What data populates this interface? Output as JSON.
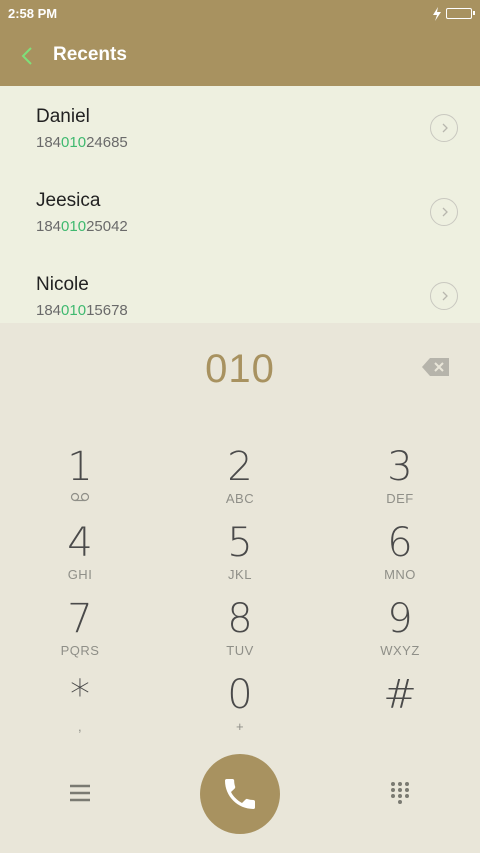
{
  "status_bar": {
    "time": "2:58 PM"
  },
  "header": {
    "title": "Recents"
  },
  "recents": [
    {
      "name": "Daniel",
      "number_prefix": "184",
      "number_match": "010",
      "number_suffix": "24685"
    },
    {
      "name": "Jeesica",
      "number_prefix": "184",
      "number_match": "010",
      "number_suffix": "25042"
    },
    {
      "name": "Nicole",
      "number_prefix": "184",
      "number_match": "010",
      "number_suffix": "15678"
    }
  ],
  "dialpad": {
    "entry": "010",
    "keys": [
      {
        "digit": "1",
        "sub": ""
      },
      {
        "digit": "2",
        "sub": "ABC"
      },
      {
        "digit": "3",
        "sub": "DEF"
      },
      {
        "digit": "4",
        "sub": "GHI"
      },
      {
        "digit": "5",
        "sub": "JKL"
      },
      {
        "digit": "6",
        "sub": "MNO"
      },
      {
        "digit": "7",
        "sub": "PQRS"
      },
      {
        "digit": "8",
        "sub": "TUV"
      },
      {
        "digit": "9",
        "sub": "WXYZ"
      },
      {
        "digit": "*",
        "sub": ","
      },
      {
        "digit": "0",
        "sub": "+"
      },
      {
        "digit": "#",
        "sub": ""
      }
    ]
  },
  "colors": {
    "accent": "#a89260",
    "match_highlight": "#3fb96f",
    "back_arrow": "#7ee07a"
  }
}
